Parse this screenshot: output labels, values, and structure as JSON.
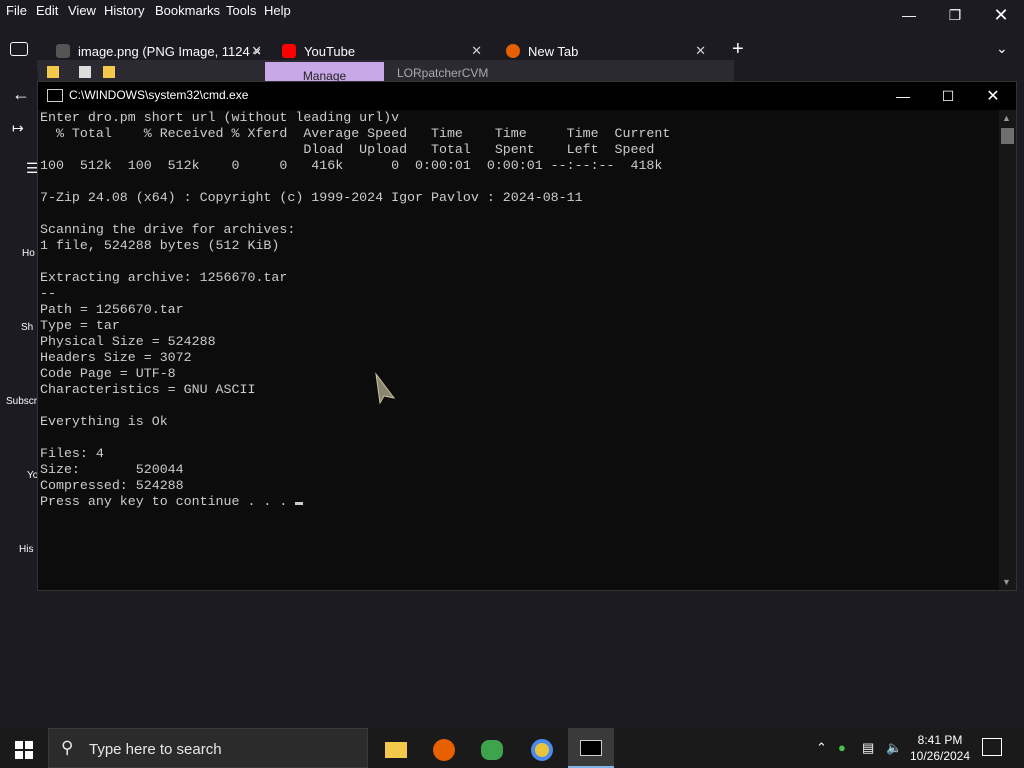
{
  "menubar": {
    "items": [
      "File",
      "Edit",
      "View",
      "History",
      "Bookmarks",
      "Tools",
      "Help"
    ]
  },
  "tabs": [
    {
      "label": "image.png (PNG Image, 1124 ×"
    },
    {
      "label": "YouTube"
    },
    {
      "label": "New Tab"
    }
  ],
  "bgwindow": {
    "manage_label": "Manage",
    "title": "LORpatcherCVM"
  },
  "sidebar": {
    "labels": [
      "Ho",
      "Sh",
      "Subscr",
      "Yo",
      "His"
    ]
  },
  "cmd": {
    "title": "C:\\WINDOWS\\system32\\cmd.exe",
    "lines": [
      "Enter dro.pm short url (without leading url)v",
      "  % Total    % Received % Xferd  Average Speed   Time    Time     Time  Current",
      "                                 Dload  Upload   Total   Spent    Left  Speed",
      "100  512k  100  512k    0     0   416k      0  0:00:01  0:00:01 --:--:--  418k",
      "",
      "7-Zip 24.08 (x64) : Copyright (c) 1999-2024 Igor Pavlov : 2024-08-11",
      "",
      "Scanning the drive for archives:",
      "1 file, 524288 bytes (512 KiB)",
      "",
      "Extracting archive: 1256670.tar",
      "--",
      "Path = 1256670.tar",
      "Type = tar",
      "Physical Size = 524288",
      "Headers Size = 3072",
      "Code Page = UTF-8",
      "Characteristics = GNU ASCII",
      "",
      "Everything is Ok",
      "",
      "Files: 4",
      "Size:       520044",
      "Compressed: 524288",
      "Press any key to continue . . . "
    ]
  },
  "taskbar": {
    "search_placeholder": "Type here to search",
    "time": "8:41 PM",
    "date": "10/26/2024"
  },
  "colors": {
    "console_bg": "#0c0c0c",
    "console_fg": "#cccccc",
    "manage_tab": "#c9a8e8"
  }
}
